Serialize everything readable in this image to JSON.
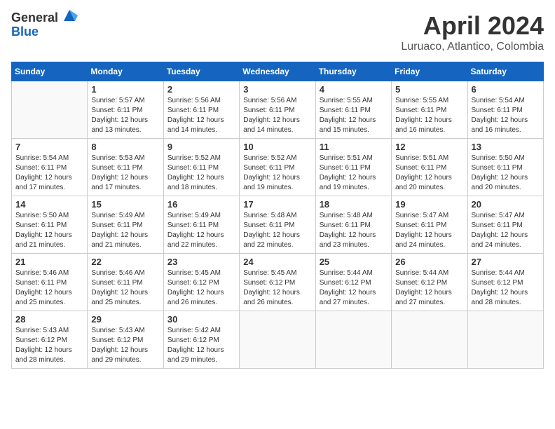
{
  "header": {
    "logo_general": "General",
    "logo_blue": "Blue",
    "month_title": "April 2024",
    "location": "Luruaco, Atlantico, Colombia"
  },
  "weekdays": [
    "Sunday",
    "Monday",
    "Tuesday",
    "Wednesday",
    "Thursday",
    "Friday",
    "Saturday"
  ],
  "weeks": [
    [
      {
        "num": "",
        "info": ""
      },
      {
        "num": "1",
        "info": "Sunrise: 5:57 AM\nSunset: 6:11 PM\nDaylight: 12 hours\nand 13 minutes."
      },
      {
        "num": "2",
        "info": "Sunrise: 5:56 AM\nSunset: 6:11 PM\nDaylight: 12 hours\nand 14 minutes."
      },
      {
        "num": "3",
        "info": "Sunrise: 5:56 AM\nSunset: 6:11 PM\nDaylight: 12 hours\nand 14 minutes."
      },
      {
        "num": "4",
        "info": "Sunrise: 5:55 AM\nSunset: 6:11 PM\nDaylight: 12 hours\nand 15 minutes."
      },
      {
        "num": "5",
        "info": "Sunrise: 5:55 AM\nSunset: 6:11 PM\nDaylight: 12 hours\nand 16 minutes."
      },
      {
        "num": "6",
        "info": "Sunrise: 5:54 AM\nSunset: 6:11 PM\nDaylight: 12 hours\nand 16 minutes."
      }
    ],
    [
      {
        "num": "7",
        "info": "Sunrise: 5:54 AM\nSunset: 6:11 PM\nDaylight: 12 hours\nand 17 minutes."
      },
      {
        "num": "8",
        "info": "Sunrise: 5:53 AM\nSunset: 6:11 PM\nDaylight: 12 hours\nand 17 minutes."
      },
      {
        "num": "9",
        "info": "Sunrise: 5:52 AM\nSunset: 6:11 PM\nDaylight: 12 hours\nand 18 minutes."
      },
      {
        "num": "10",
        "info": "Sunrise: 5:52 AM\nSunset: 6:11 PM\nDaylight: 12 hours\nand 19 minutes."
      },
      {
        "num": "11",
        "info": "Sunrise: 5:51 AM\nSunset: 6:11 PM\nDaylight: 12 hours\nand 19 minutes."
      },
      {
        "num": "12",
        "info": "Sunrise: 5:51 AM\nSunset: 6:11 PM\nDaylight: 12 hours\nand 20 minutes."
      },
      {
        "num": "13",
        "info": "Sunrise: 5:50 AM\nSunset: 6:11 PM\nDaylight: 12 hours\nand 20 minutes."
      }
    ],
    [
      {
        "num": "14",
        "info": "Sunrise: 5:50 AM\nSunset: 6:11 PM\nDaylight: 12 hours\nand 21 minutes."
      },
      {
        "num": "15",
        "info": "Sunrise: 5:49 AM\nSunset: 6:11 PM\nDaylight: 12 hours\nand 21 minutes."
      },
      {
        "num": "16",
        "info": "Sunrise: 5:49 AM\nSunset: 6:11 PM\nDaylight: 12 hours\nand 22 minutes."
      },
      {
        "num": "17",
        "info": "Sunrise: 5:48 AM\nSunset: 6:11 PM\nDaylight: 12 hours\nand 22 minutes."
      },
      {
        "num": "18",
        "info": "Sunrise: 5:48 AM\nSunset: 6:11 PM\nDaylight: 12 hours\nand 23 minutes."
      },
      {
        "num": "19",
        "info": "Sunrise: 5:47 AM\nSunset: 6:11 PM\nDaylight: 12 hours\nand 24 minutes."
      },
      {
        "num": "20",
        "info": "Sunrise: 5:47 AM\nSunset: 6:11 PM\nDaylight: 12 hours\nand 24 minutes."
      }
    ],
    [
      {
        "num": "21",
        "info": "Sunrise: 5:46 AM\nSunset: 6:11 PM\nDaylight: 12 hours\nand 25 minutes."
      },
      {
        "num": "22",
        "info": "Sunrise: 5:46 AM\nSunset: 6:11 PM\nDaylight: 12 hours\nand 25 minutes."
      },
      {
        "num": "23",
        "info": "Sunrise: 5:45 AM\nSunset: 6:12 PM\nDaylight: 12 hours\nand 26 minutes."
      },
      {
        "num": "24",
        "info": "Sunrise: 5:45 AM\nSunset: 6:12 PM\nDaylight: 12 hours\nand 26 minutes."
      },
      {
        "num": "25",
        "info": "Sunrise: 5:44 AM\nSunset: 6:12 PM\nDaylight: 12 hours\nand 27 minutes."
      },
      {
        "num": "26",
        "info": "Sunrise: 5:44 AM\nSunset: 6:12 PM\nDaylight: 12 hours\nand 27 minutes."
      },
      {
        "num": "27",
        "info": "Sunrise: 5:44 AM\nSunset: 6:12 PM\nDaylight: 12 hours\nand 28 minutes."
      }
    ],
    [
      {
        "num": "28",
        "info": "Sunrise: 5:43 AM\nSunset: 6:12 PM\nDaylight: 12 hours\nand 28 minutes."
      },
      {
        "num": "29",
        "info": "Sunrise: 5:43 AM\nSunset: 6:12 PM\nDaylight: 12 hours\nand 29 minutes."
      },
      {
        "num": "30",
        "info": "Sunrise: 5:42 AM\nSunset: 6:12 PM\nDaylight: 12 hours\nand 29 minutes."
      },
      {
        "num": "",
        "info": ""
      },
      {
        "num": "",
        "info": ""
      },
      {
        "num": "",
        "info": ""
      },
      {
        "num": "",
        "info": ""
      }
    ]
  ]
}
